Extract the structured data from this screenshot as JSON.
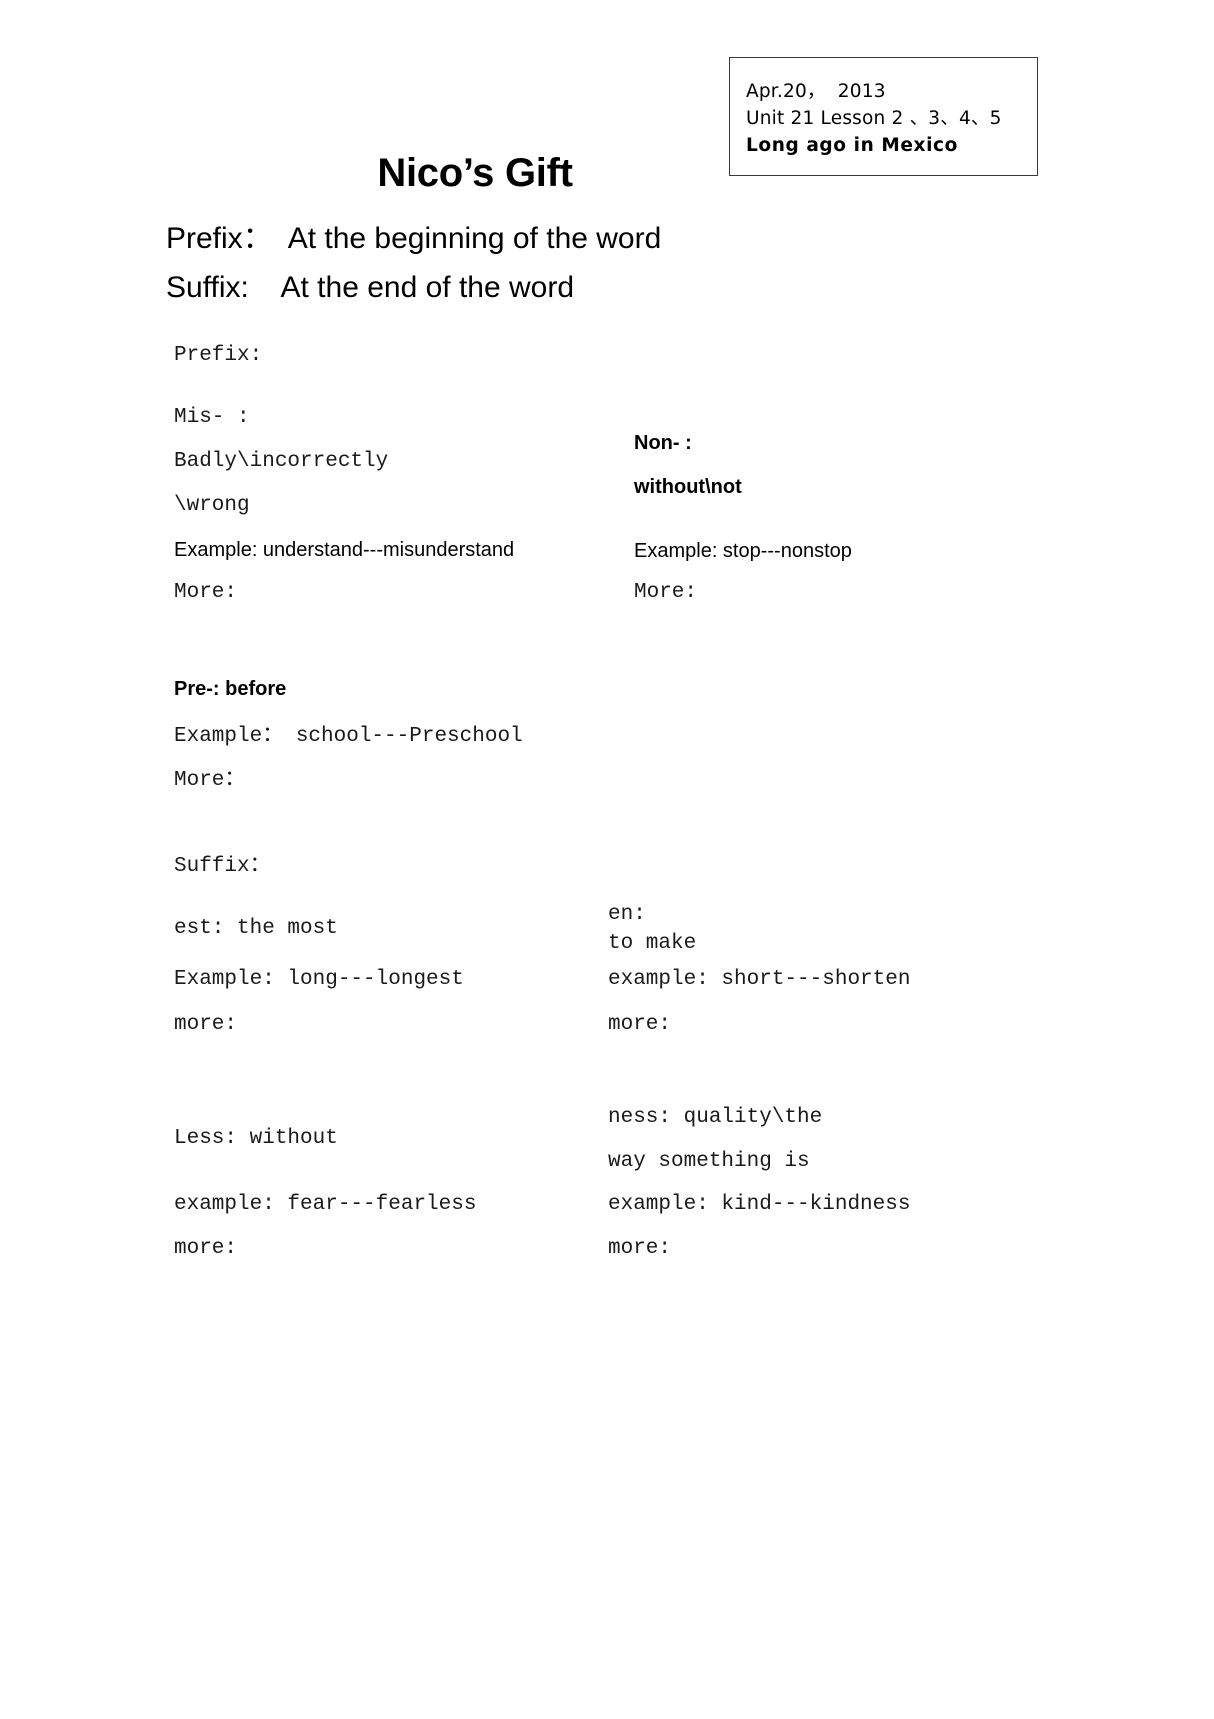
{
  "header_box": {
    "line1": "Apr.20，  2013",
    "line2": "Unit 21 Lesson 2 、3、4、5",
    "line3": "Long ago in Mexico"
  },
  "title": "Nico’s Gift",
  "definitions": {
    "prefix": "Prefix：  At the beginning of the word",
    "suffix": "Suffix:    At the end of the word"
  },
  "prefix_section": {
    "heading": "Prefix:",
    "items": [
      {
        "name": "Mis- :",
        "meaning_line1": "Badly\\incorrectly",
        "meaning_line2": "\\wrong",
        "example": "Example: understand---misunderstand",
        "more": "More:"
      },
      {
        "name": "Non- :",
        "meaning_line1": "without\\not",
        "example": "Example: stop---nonstop",
        "more": "More:"
      },
      {
        "name": "Pre-: before",
        "example": "Example： school---Preschool",
        "more": "More："
      }
    ]
  },
  "suffix_section": {
    "heading": "Suffix：",
    "items": [
      {
        "name": "est: the most",
        "example": "Example: long---longest",
        "more": "more:"
      },
      {
        "name_line1": "en:",
        "name_line2": "to make",
        "example": "example: short---shorten",
        "more": "more:"
      },
      {
        "name": "Less: without",
        "example": "example: fear---fearless",
        "more": "more:"
      },
      {
        "name_line1": "ness: quality\\the",
        "name_line2": "way something is",
        "example": "example: kind---kindness",
        "more": "more:"
      }
    ]
  }
}
